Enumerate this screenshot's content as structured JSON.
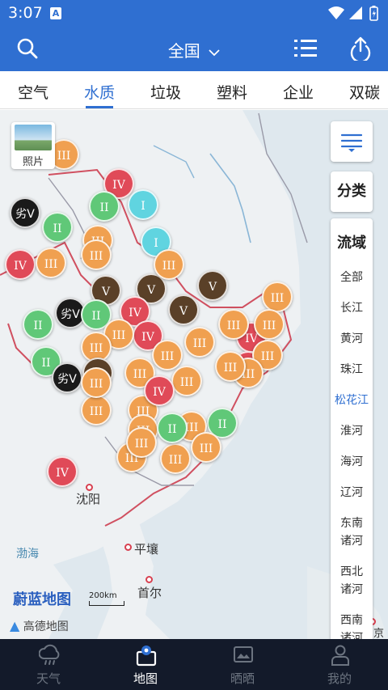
{
  "status_bar": {
    "time": "3:07",
    "sim_label": "A"
  },
  "header": {
    "region": "全国"
  },
  "tabs": [
    {
      "label": "空气",
      "active": false
    },
    {
      "label": "水质",
      "active": true
    },
    {
      "label": "垃圾",
      "active": false
    },
    {
      "label": "塑料",
      "active": false
    },
    {
      "label": "企业",
      "active": false
    },
    {
      "label": "双碳",
      "active": false
    }
  ],
  "map": {
    "photo_label": "照片",
    "category_label": "分类",
    "basin": {
      "title": "流域",
      "items": [
        "全部",
        "长江",
        "黄河",
        "珠江",
        "松花江",
        "淮河",
        "海河",
        "辽河",
        "东南诸河",
        "西北诸河",
        "西南诸河"
      ],
      "selected": "松花江"
    },
    "place_labels": {
      "shenyang": "沈阳",
      "pyongyang": "平壤",
      "seoul": "首尔",
      "bohai": "渤海",
      "edge_partial": "京"
    },
    "brand": "蔚蓝地图",
    "scale_label": "200km",
    "provider": "高德地图",
    "markers": [
      "III",
      "IV",
      "II",
      "I",
      "劣V",
      "II",
      "IV",
      "III",
      "I",
      "III",
      "III",
      "劣V",
      "V",
      "V",
      "V",
      "IV",
      "V",
      "III",
      "II",
      "II",
      "IV",
      "III",
      "IV",
      "III",
      "III",
      "III",
      "III",
      "II",
      "劣V",
      "III",
      "V",
      "IV",
      "III",
      "III",
      "III",
      "III",
      "III",
      "III",
      "II",
      "III",
      "III",
      "III",
      "III",
      "III",
      "III",
      "IV",
      "II",
      "III",
      "III",
      "III",
      "IV"
    ]
  },
  "bottom_nav": [
    {
      "label": "天气",
      "icon": "cloud-rain-icon",
      "active": false
    },
    {
      "label": "地图",
      "icon": "map-pin-icon",
      "active": true
    },
    {
      "label": "晒晒",
      "icon": "photo-frame-icon",
      "active": false
    },
    {
      "label": "我的",
      "icon": "user-icon",
      "active": false
    }
  ],
  "colors": {
    "brand_blue": "#2f6fd1",
    "grade_I": "#60d4e0",
    "grade_II": "#60c878",
    "grade_III": "#f0a050",
    "grade_IV": "#e04a58",
    "grade_V": "#5a4028",
    "grade_worse_V": "#1a1a1a",
    "nav_background": "#131a2a"
  }
}
